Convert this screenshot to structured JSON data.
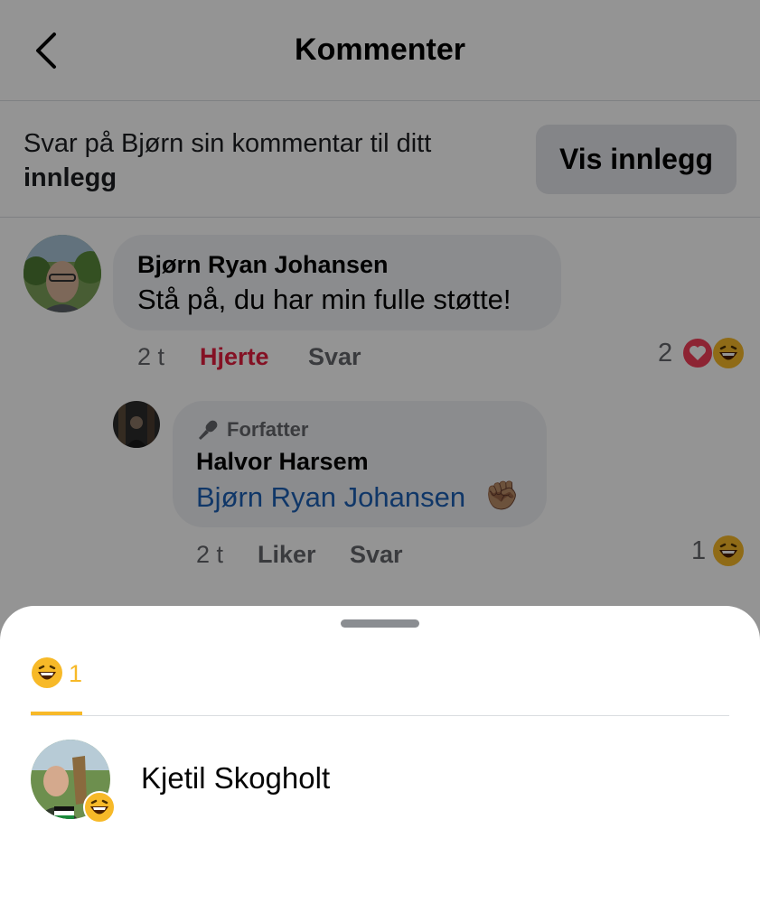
{
  "header": {
    "title": "Kommenter"
  },
  "reply_bar": {
    "text_prefix": "Svar på Bjørn sin kommentar til ditt",
    "text_bold": "innlegg",
    "button_label": "Vis innlegg"
  },
  "comments": [
    {
      "author": "Bjørn Ryan Johansen",
      "text": "Stå på, du har min fulle støtte!",
      "time": "2 t",
      "action_like": "Hjerte",
      "action_reply": "Svar",
      "reaction_count": "2"
    },
    {
      "badge": "Forfatter",
      "author": "Halvor Harsem",
      "mention": "Bjørn Ryan Johansen",
      "emoji": "✊🏽",
      "time": "2 t",
      "action_like": "Liker",
      "action_reply": "Svar",
      "reaction_count": "1"
    }
  ],
  "sheet": {
    "tab_count": "1",
    "users": [
      {
        "name": "Kjetil Skogholt"
      }
    ]
  },
  "colors": {
    "heart": "#e41e3f",
    "mention": "#1d5fb4",
    "tab_accent": "#f7b928"
  }
}
